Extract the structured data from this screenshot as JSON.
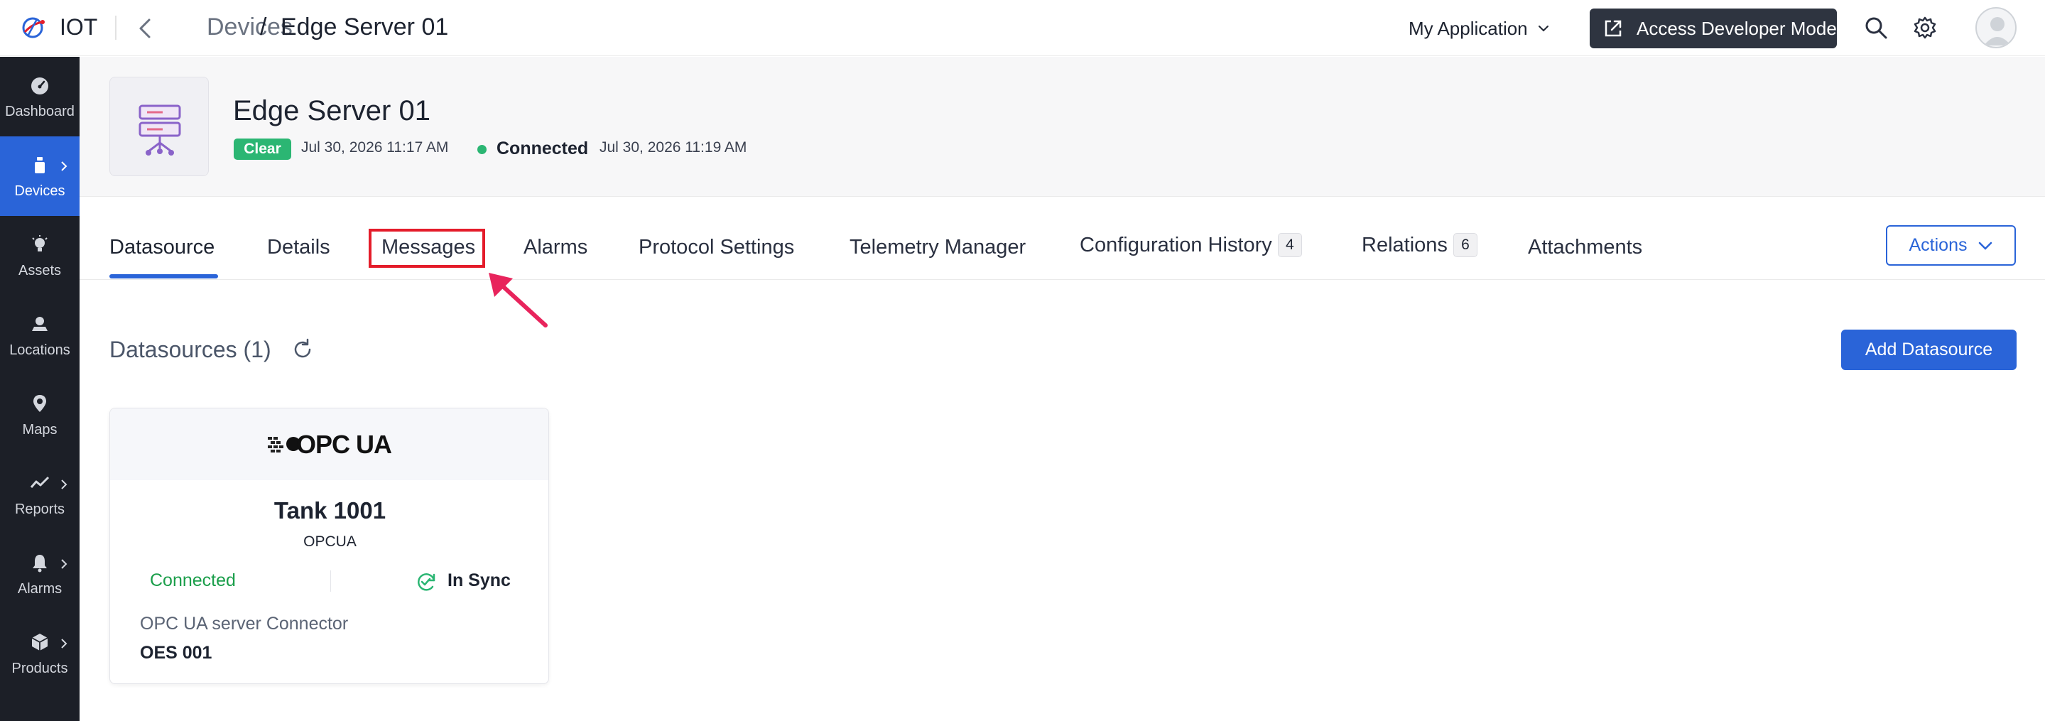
{
  "topbar": {
    "app_name": "IOT",
    "breadcrumb": {
      "parent": "Devices",
      "separator": "/",
      "current": "Edge Server 01"
    },
    "app_selector": "My Application",
    "dev_mode_button": "Access Developer Mode",
    "icons": [
      "logo-icon",
      "back-chevron-icon",
      "search-icon",
      "gear-icon",
      "user-avatar-icon"
    ]
  },
  "sidebar": {
    "items": [
      {
        "label": "Dashboard",
        "icon": "dashboard-icon",
        "active": false,
        "has_submenu": false
      },
      {
        "label": "Devices",
        "icon": "devices-icon",
        "active": true,
        "has_submenu": true
      },
      {
        "label": "Assets",
        "icon": "assets-icon",
        "active": false,
        "has_submenu": false
      },
      {
        "label": "Locations",
        "icon": "locations-icon",
        "active": false,
        "has_submenu": false
      },
      {
        "label": "Maps",
        "icon": "maps-icon",
        "active": false,
        "has_submenu": false
      },
      {
        "label": "Reports",
        "icon": "reports-icon",
        "active": false,
        "has_submenu": true
      },
      {
        "label": "Alarms",
        "icon": "alarms-icon",
        "active": false,
        "has_submenu": true
      },
      {
        "label": "Products",
        "icon": "products-icon",
        "active": false,
        "has_submenu": true
      }
    ]
  },
  "device": {
    "title": "Edge Server 01",
    "status_chip": "Clear",
    "status_time": "Jul 30, 2026 11:17 AM",
    "connection_label": "Connected",
    "connection_time": "Jul 30, 2026 11:19 AM",
    "icon": "server-icon"
  },
  "tabs": [
    {
      "label": "Datasource",
      "active": true
    },
    {
      "label": "Details",
      "active": false
    },
    {
      "label": "Messages",
      "active": false,
      "highlighted": true
    },
    {
      "label": "Alarms",
      "active": false
    },
    {
      "label": "Protocol Settings",
      "active": false
    },
    {
      "label": "Telemetry Manager",
      "active": false
    },
    {
      "label": "Configuration History",
      "active": false,
      "badge": "4"
    },
    {
      "label": "Relations",
      "active": false,
      "badge": "6"
    },
    {
      "label": "Attachments",
      "active": false
    }
  ],
  "actions_button": "Actions",
  "content": {
    "section_title": "Datasources (1)",
    "add_button": "Add Datasource"
  },
  "datasource_card": {
    "logo_text": "OPC UA",
    "name": "Tank 1001",
    "protocol": "OPCUA",
    "status": "Connected",
    "sync": "In Sync",
    "connector_name": "OPC UA server Connector",
    "connector_id": "OES 001"
  },
  "colors": {
    "accent": "#2a64d8",
    "sidebar_bg": "#1c1f27",
    "success": "#2bb673",
    "annotation": "#e41c2a",
    "dev_button_bg": "#2e3440"
  }
}
